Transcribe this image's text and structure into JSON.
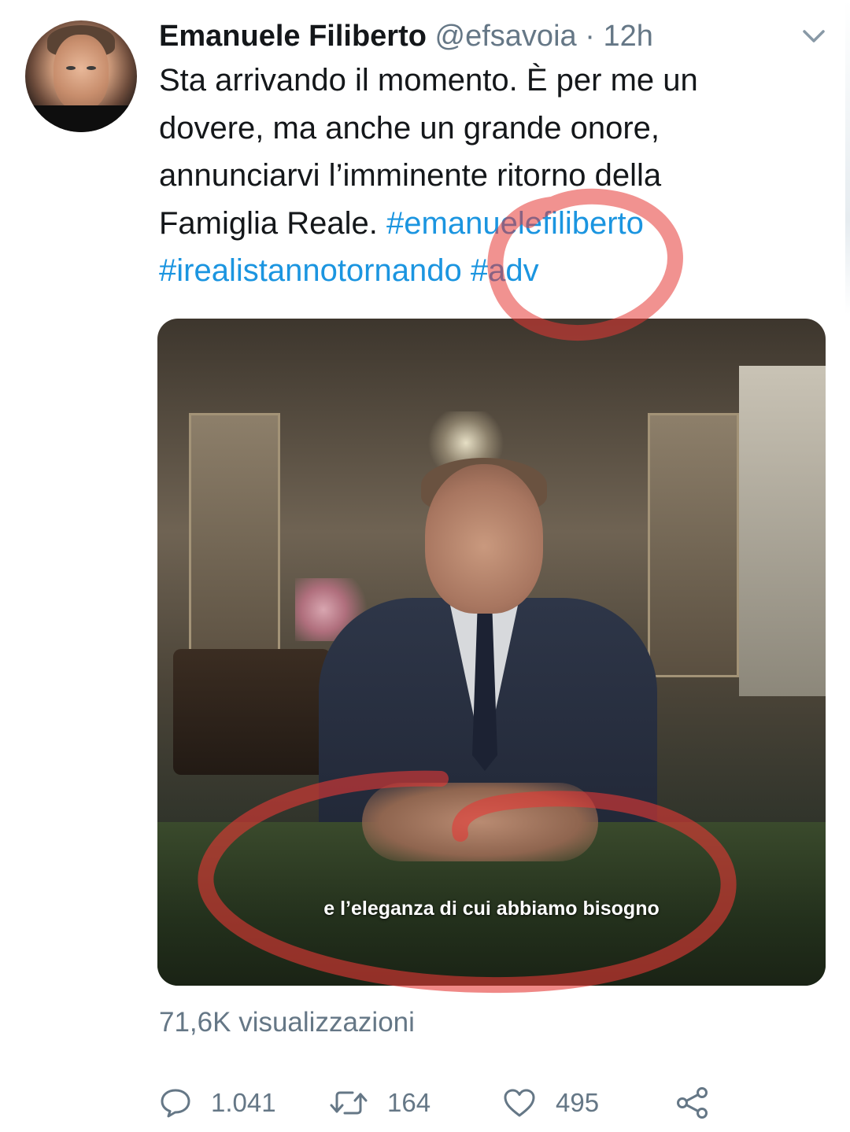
{
  "tweet": {
    "author_name": "Emanuele Filiberto",
    "author_handle": "@efsavoia",
    "separator": "·",
    "timestamp": "12h",
    "text_lines": [
      "Sta arrivando il momento. È per me un",
      "dovere, ma anche un grande onore,",
      "annunciarvi l’imminente ritorno della"
    ],
    "text_line4_prefix": "Famiglia Reale. ",
    "hashtags": [
      "#emanuelefiliberto",
      "#irealistannotornando",
      "#adv"
    ],
    "hashtag_color": "#1b95e0",
    "video_subtitle": "e l’eleganza di cui abbiamo bisogno",
    "views": "71,6K visualizzazioni"
  },
  "actions": {
    "reply": {
      "icon": "reply-icon",
      "count": "1.041"
    },
    "retweet": {
      "icon": "retweet-icon",
      "count": "164"
    },
    "like": {
      "icon": "heart-icon",
      "count": "495"
    },
    "share": {
      "icon": "share-icon"
    }
  },
  "colors": {
    "text": "#14171a",
    "secondary": "#657786",
    "annotation_red": "#e53935"
  }
}
